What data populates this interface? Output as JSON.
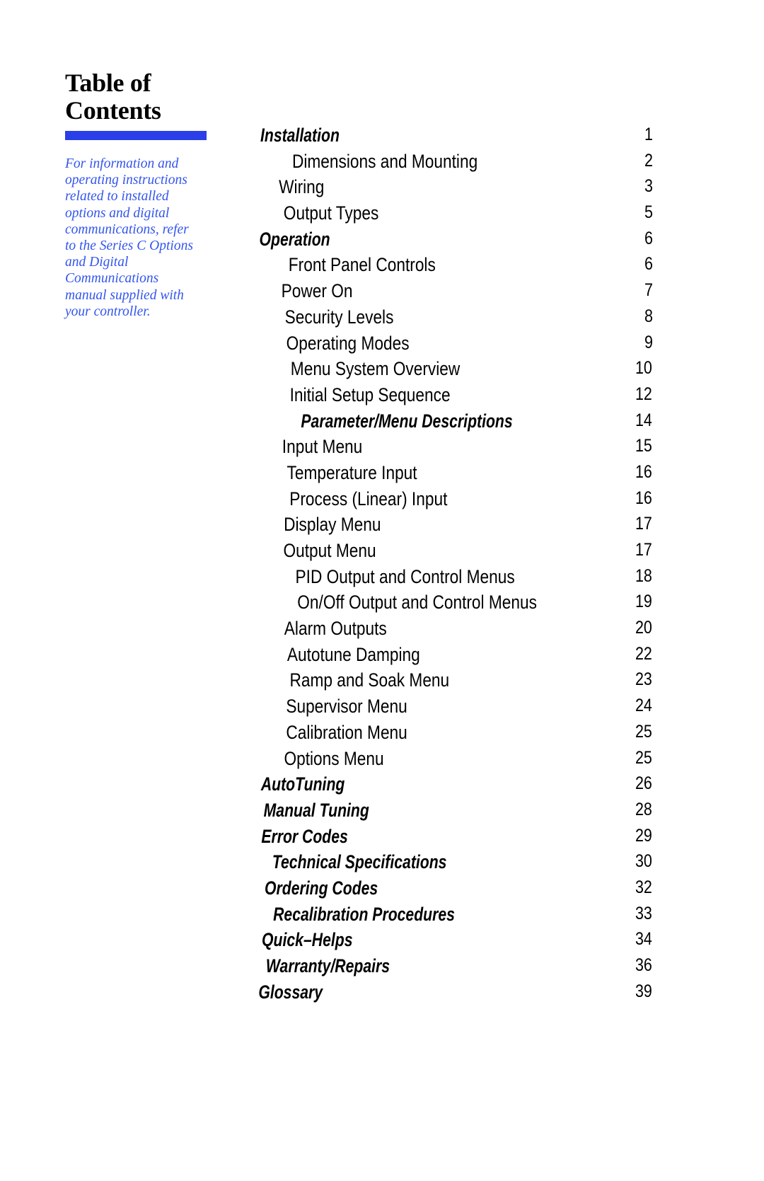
{
  "title": {
    "line1": "Table of",
    "line2": "Contents"
  },
  "accent_color": "#2A3FE8",
  "note_color": "#3355EE",
  "sidebar_note": "For information and operating instructions related to installed options and digital communications, refer to the Series C Options and Digital Communications manual supplied with your controller.",
  "toc": {
    "entries": [
      {
        "label": "Installation",
        "page": "1",
        "level": 0,
        "style": "head"
      },
      {
        "label": "Dimensions and Mounting",
        "page": "2",
        "level": 1,
        "style": "sub"
      },
      {
        "label": "Wiring",
        "page": "3",
        "level": 1,
        "style": "sub"
      },
      {
        "label": "Output Types",
        "page": "5",
        "level": 1,
        "style": "sub"
      },
      {
        "label": "Operation",
        "page": "6",
        "level": 0,
        "style": "head"
      },
      {
        "label": "Front Panel Controls",
        "page": "6",
        "level": 1,
        "style": "sub"
      },
      {
        "label": "Power On",
        "page": "7",
        "level": 1,
        "style": "sub"
      },
      {
        "label": "Security Levels",
        "page": "8",
        "level": 1,
        "style": "sub"
      },
      {
        "label": "Operating Modes",
        "page": "9",
        "level": 1,
        "style": "sub"
      },
      {
        "label": "Menu System Overview",
        "page": "10",
        "level": 1,
        "style": "sub"
      },
      {
        "label": "Initial Setup Sequence",
        "page": "12",
        "level": 1,
        "style": "sub"
      },
      {
        "label": "Parameter/Menu Descriptions",
        "page": "14",
        "level": 1,
        "style": "head"
      },
      {
        "label": "Input Menu",
        "page": "15",
        "level": 1,
        "style": "sub"
      },
      {
        "label": "Temperature Input",
        "page": "16",
        "level": 1,
        "style": "sub"
      },
      {
        "label": "Process (Linear) Input",
        "page": "16",
        "level": 1,
        "style": "sub"
      },
      {
        "label": "Display Menu",
        "page": "17",
        "level": 1,
        "style": "sub"
      },
      {
        "label": "Output Menu",
        "page": "17",
        "level": 1,
        "style": "sub"
      },
      {
        "label": "PID Output and Control Menus",
        "page": "18",
        "level": 1,
        "style": "sub"
      },
      {
        "label": "On/Off Output and Control Menus",
        "page": "19",
        "level": 1,
        "style": "sub"
      },
      {
        "label": "Alarm Outputs",
        "page": "20",
        "level": 1,
        "style": "sub"
      },
      {
        "label": "Autotune Damping",
        "page": "22",
        "level": 1,
        "style": "sub"
      },
      {
        "label": "Ramp and Soak Menu",
        "page": "23",
        "level": 1,
        "style": "sub"
      },
      {
        "label": "Supervisor Menu",
        "page": "24",
        "level": 1,
        "style": "sub"
      },
      {
        "label": "Calibration Menu",
        "page": "25",
        "level": 1,
        "style": "sub"
      },
      {
        "label": "Options Menu",
        "page": "25",
        "level": 1,
        "style": "sub"
      },
      {
        "label": "AutoTuning",
        "page": "26",
        "level": 0,
        "style": "head"
      },
      {
        "label": "Manual Tuning",
        "page": "28",
        "level": 0,
        "style": "head"
      },
      {
        "label": "Error Codes",
        "page": "29",
        "level": 0,
        "style": "head"
      },
      {
        "label": "Technical Specifications",
        "page": "30",
        "level": 0,
        "style": "head"
      },
      {
        "label": "Ordering Codes",
        "page": "32",
        "level": 0,
        "style": "head"
      },
      {
        "label": "Recalibration Procedures",
        "page": "33",
        "level": 0,
        "style": "head"
      },
      {
        "label": "Quick–Helps",
        "page": "34",
        "level": 0,
        "style": "head"
      },
      {
        "label": "Warranty/Repairs",
        "page": "36",
        "level": 0,
        "style": "head"
      },
      {
        "label": "Glossary",
        "page": "39",
        "level": 0,
        "style": "head"
      }
    ]
  }
}
